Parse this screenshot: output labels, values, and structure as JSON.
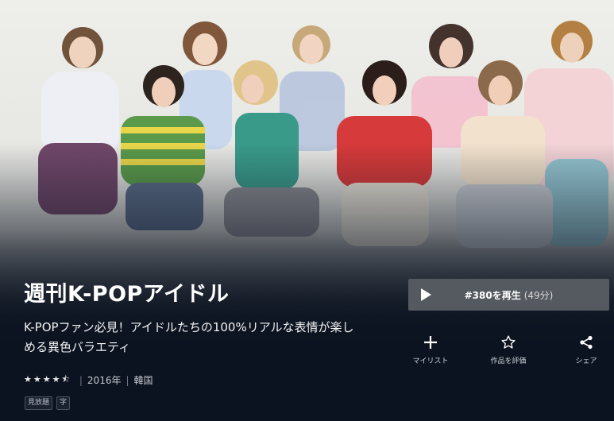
{
  "show": {
    "title": "週刊K-POPアイドル",
    "description": "K-POPファン必見！アイドルたちの100%リアルな表情が楽しめる異色バラエティ",
    "rating_stars": "★★★★⯪",
    "year": "2016年",
    "country": "韓国",
    "badges": [
      "見放題",
      "字"
    ]
  },
  "play_button": {
    "label": "#380を再生",
    "duration": "(49分)",
    "icon": "play-icon"
  },
  "actions": [
    {
      "label": "マイリスト",
      "icon": "plus-icon"
    },
    {
      "label": "作品を評価",
      "icon": "star-outline-icon"
    },
    {
      "label": "シェア",
      "icon": "share-icon"
    }
  ],
  "colors": {
    "background": "#0b1320",
    "play_button": "#555a61"
  }
}
